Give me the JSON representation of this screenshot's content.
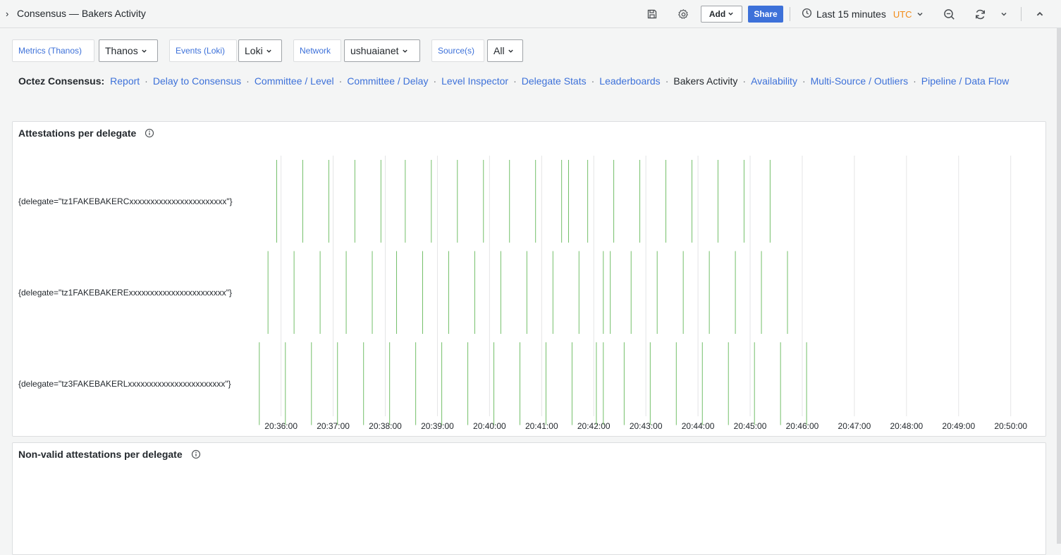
{
  "header": {
    "title": "Consensus — Bakers Activity",
    "add_label": "Add",
    "share_label": "Share",
    "time_range": "Last 15 minutes",
    "timezone": "UTC"
  },
  "variables": [
    {
      "label": "Metrics (Thanos)",
      "value": "Thanos"
    },
    {
      "label": "Events (Loki)",
      "value": "Loki"
    },
    {
      "label": "Network",
      "value": "ushuaianet"
    },
    {
      "label": "Source(s)",
      "value": "All"
    }
  ],
  "nav": {
    "label": "Octez Consensus:",
    "links": [
      {
        "text": "Report",
        "current": false
      },
      {
        "text": "Delay to Consensus",
        "current": false
      },
      {
        "text": "Committee / Level",
        "current": false
      },
      {
        "text": "Committee / Delay",
        "current": false
      },
      {
        "text": "Level Inspector",
        "current": false
      },
      {
        "text": "Delegate Stats",
        "current": false
      },
      {
        "text": "Leaderboards",
        "current": false
      },
      {
        "text": "Bakers Activity",
        "current": true
      },
      {
        "text": "Availability",
        "current": false
      },
      {
        "text": "Multi-Source / Outliers",
        "current": false
      },
      {
        "text": "Pipeline / Data Flow",
        "current": false
      }
    ]
  },
  "panels": {
    "attestations_title": "Attestations per delegate",
    "nonvalid_title": "Non-valid attestations per delegate"
  },
  "colors": {
    "accent": "#3d71d9",
    "event_line": "#73bf69",
    "grid": "#e4e5e6",
    "timezone": "#f28b17"
  },
  "chart_data": {
    "type": "timeline",
    "x_range": [
      "20:35:40",
      "20:50:40"
    ],
    "x_ticks": [
      "20:36:00",
      "20:37:00",
      "20:38:00",
      "20:39:00",
      "20:40:00",
      "20:41:00",
      "20:42:00",
      "20:43:00",
      "20:44:00",
      "20:45:00",
      "20:46:00",
      "20:47:00",
      "20:48:00",
      "20:49:00",
      "20:50:00"
    ],
    "series": [
      {
        "name": "{delegate=\"tz1FAKEBAKERCxxxxxxxxxxxxxxxxxxxxxxx\"}",
        "events": [
          "20:35:55",
          "20:36:25",
          "20:36:55",
          "20:37:25",
          "20:37:55",
          "20:38:23",
          "20:38:53",
          "20:39:23",
          "20:39:53",
          "20:40:23",
          "20:40:53",
          "20:41:23",
          "20:41:31",
          "20:41:53",
          "20:42:23",
          "20:42:53",
          "20:43:23",
          "20:43:53",
          "20:44:23",
          "20:44:53",
          "20:45:23"
        ]
      },
      {
        "name": "{delegate=\"tz1FAKEBAKERExxxxxxxxxxxxxxxxxxxxxxx\"}",
        "events": [
          "20:35:45",
          "20:36:15",
          "20:36:45",
          "20:37:15",
          "20:37:45",
          "20:38:13",
          "20:38:43",
          "20:39:13",
          "20:39:43",
          "20:40:13",
          "20:40:43",
          "20:41:13",
          "20:41:43",
          "20:42:11",
          "20:42:19",
          "20:42:43",
          "20:43:13",
          "20:43:43",
          "20:44:13",
          "20:44:43",
          "20:45:13",
          "20:45:43"
        ]
      },
      {
        "name": "{delegate=\"tz3FAKEBAKERLxxxxxxxxxxxxxxxxxxxxxxx\"}",
        "events": [
          "20:35:35",
          "20:36:05",
          "20:36:35",
          "20:37:05",
          "20:37:35",
          "20:38:05",
          "20:38:35",
          "20:39:05",
          "20:39:35",
          "20:40:05",
          "20:40:35",
          "20:41:05",
          "20:41:35",
          "20:42:03",
          "20:42:11",
          "20:42:35",
          "20:43:05",
          "20:43:35",
          "20:44:05",
          "20:44:35",
          "20:45:05",
          "20:45:35",
          "20:46:05"
        ]
      }
    ]
  }
}
